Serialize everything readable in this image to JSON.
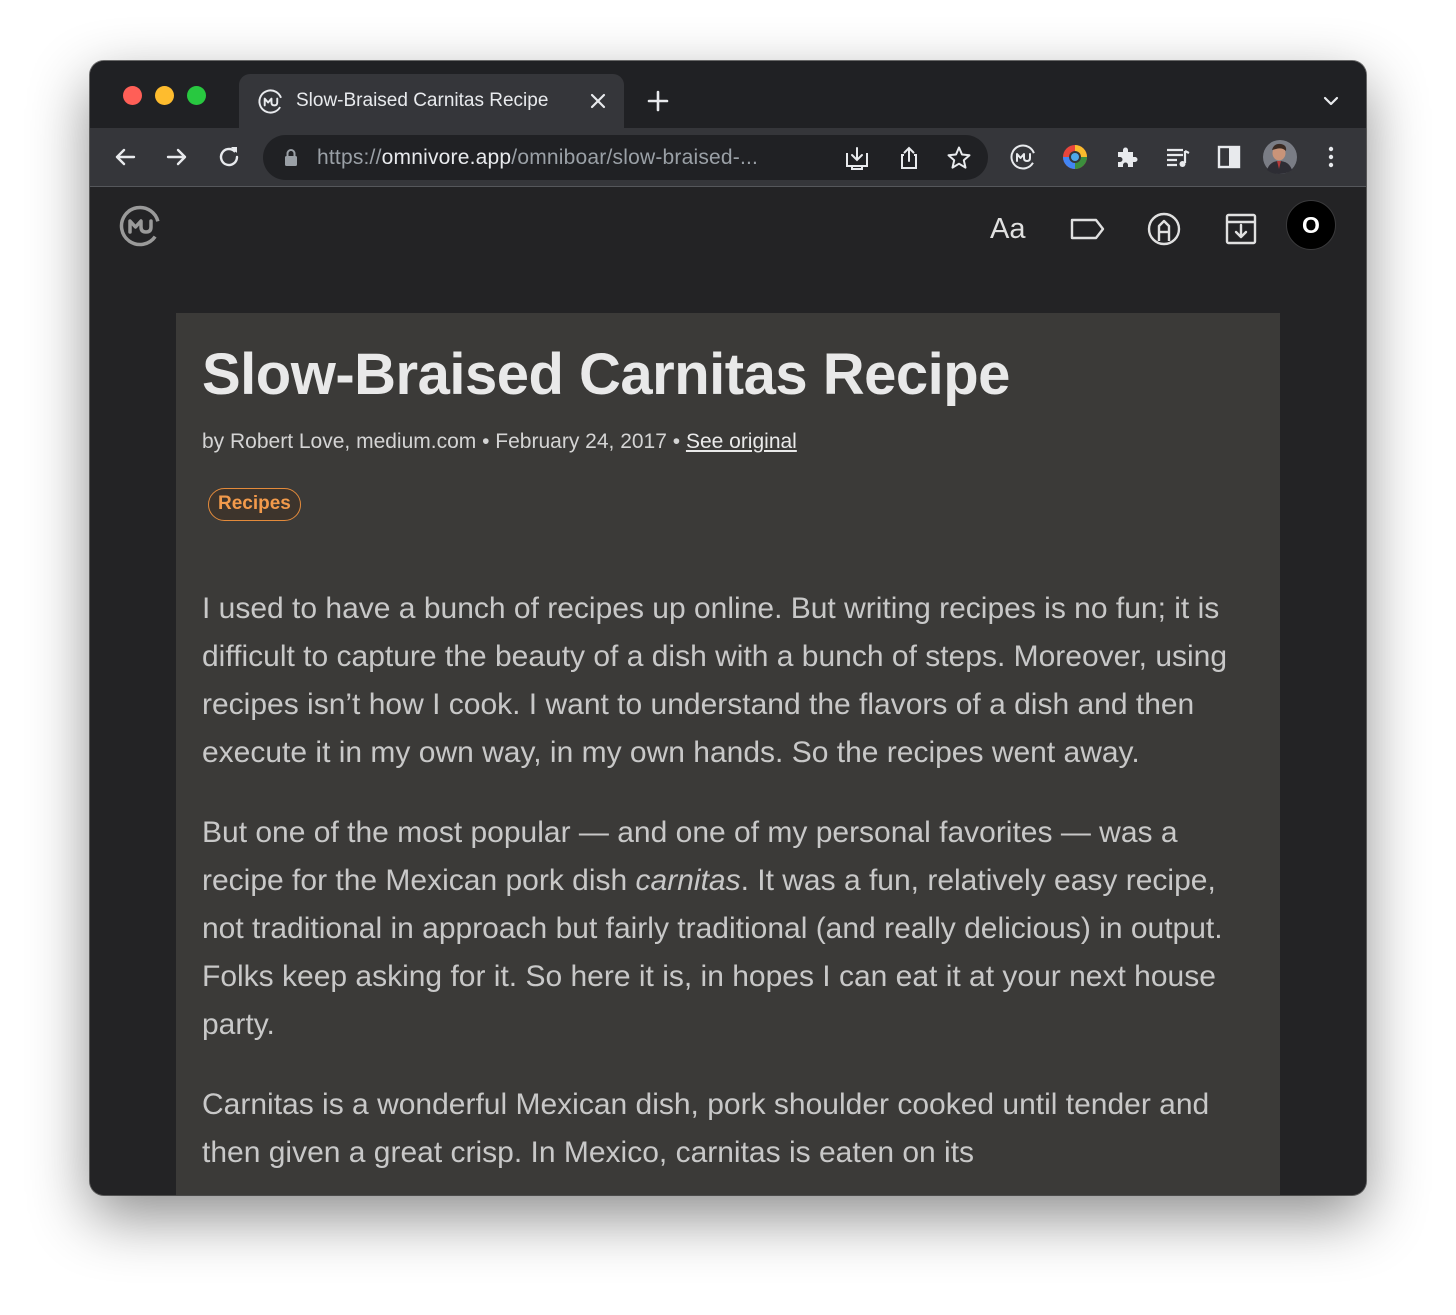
{
  "browser": {
    "tab": {
      "title": "Slow-Braised Carnitas Recipe",
      "favicon": "omnivore-logo-icon"
    },
    "url": {
      "scheme": "https://",
      "host": "omnivore.app",
      "path": "/omniboar/slow-braised-..."
    },
    "toolbar_icons": [
      "back-arrow-icon",
      "forward-arrow-icon",
      "reload-icon",
      "install-app-icon",
      "share-icon",
      "bookmark-star-icon",
      "omnivore-extension-icon",
      "color-extension-icon",
      "extensions-puzzle-icon",
      "reading-list-icon",
      "side-panel-icon",
      "profile-avatar-icon",
      "more-menu-icon"
    ]
  },
  "app_header": {
    "icons": [
      "display-settings-icon",
      "labels-icon",
      "notebook-icon",
      "archive-icon"
    ],
    "display_settings_label": "Aa",
    "avatar_initial": "O"
  },
  "article": {
    "title": "Slow-Braised Carnitas Recipe",
    "byline_prefix": "by Robert Love, medium.com • February 24, 2017 • ",
    "see_original": "See original",
    "label": "Recipes",
    "paragraph1": "I used to have a bunch of recipes up online. But writing recipes is no fun; it is difficult to capture the beauty of a dish with a bunch of steps. Moreover, using recipes isn’t how I cook. I want to understand the flavors of a dish and then execute it in my own way, in my own hands. So the recipes went away.",
    "paragraph2_start": "But one of the most popular — and one of my personal favorites — was a recipe for the Mexican pork dish ",
    "paragraph2_em": "carnitas",
    "paragraph2_end": ". It was a fun, relatively easy recipe, not traditional in approach but fairly traditional (and really delicious) in output. Folks keep asking for it. So here it is, in hopes I can eat it at your next house party.",
    "paragraph3": "Carnitas is a wonderful Mexican dish, pork shoulder cooked until tender and then given a great crisp. In Mexico, carnitas is eaten on its"
  },
  "colors": {
    "accent_label": "#e38a3b",
    "article_bg": "#3b3a38",
    "app_bg": "#232325"
  }
}
